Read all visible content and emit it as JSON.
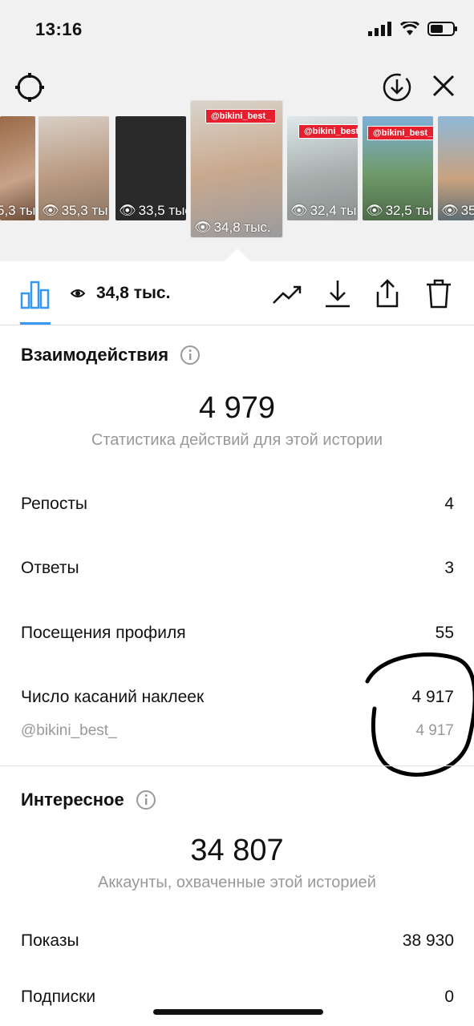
{
  "status_bar": {
    "time": "13:16"
  },
  "stories": [
    {
      "views": "5,3 тыс.",
      "tag": ""
    },
    {
      "views": "35,3 ты",
      "tag": ""
    },
    {
      "views": "33,5 тыс.",
      "tag": ""
    },
    {
      "views": "34,8 тыс.",
      "tag": "@bikini_best_"
    },
    {
      "views": "32,4 ты",
      "tag": "@bikini_best_"
    },
    {
      "views": "32,5 ты",
      "tag": "@bikini_best_"
    },
    {
      "views": "35",
      "tag": ""
    }
  ],
  "action_bar": {
    "views": "34,8 тыс."
  },
  "interactions": {
    "title": "Взаимодействия",
    "total": "4 979",
    "caption": "Статистика действий для этой истории",
    "rows": [
      {
        "label": "Репосты",
        "value": "4"
      },
      {
        "label": "Ответы",
        "value": "3"
      },
      {
        "label": "Посещения профиля",
        "value": "55"
      },
      {
        "label": "Число касаний наклеек",
        "value": "4 917"
      }
    ],
    "sticker_sub": {
      "label": "@bikini_best_",
      "value": "4 917"
    }
  },
  "discovery": {
    "title": "Интересное",
    "total": "34 807",
    "caption": "Аккаунты, охваченные этой историей",
    "rows": [
      {
        "label": "Показы",
        "value": "38 930"
      },
      {
        "label": "Подписки",
        "value": "0"
      }
    ]
  },
  "colors": {
    "accent": "#3897f0",
    "tag_red": "#e61e2d",
    "muted": "#999999"
  }
}
